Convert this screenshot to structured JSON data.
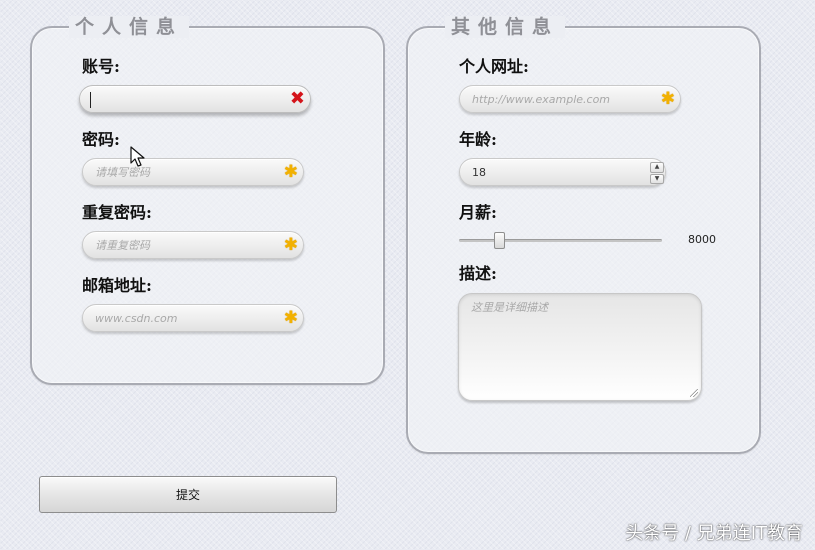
{
  "personal": {
    "legend": "个人信息",
    "account": {
      "label": "账号:",
      "value": "",
      "placeholder": ""
    },
    "password": {
      "label": "密码:",
      "placeholder": "请填写密码"
    },
    "confirm_password": {
      "label": "重复密码:",
      "placeholder": "请重复密码"
    },
    "email": {
      "label": "邮箱地址:",
      "placeholder": "www.csdn.com"
    }
  },
  "other": {
    "legend": "其他信息",
    "website": {
      "label": "个人网址:",
      "placeholder": "http://www.example.com"
    },
    "age": {
      "label": "年龄:",
      "value": "18"
    },
    "salary": {
      "label": "月薪:",
      "value": "8000",
      "level": 0.18
    },
    "description": {
      "label": "描述:",
      "placeholder": "这里是详细描述"
    }
  },
  "submit_label": "提交",
  "watermark": "头条号 / 兄弟连IT教育",
  "icons": {
    "required": "asterisk-icon",
    "invalid": "x-mark-icon",
    "spin_up": "spin-up-icon",
    "spin_down": "spin-down-icon",
    "cursor": "mouse-cursor-icon",
    "resize": "resize-grip-icon"
  },
  "colors": {
    "required_star": "#f2b100",
    "invalid_x": "#d4141a",
    "legend": "#8f9096"
  }
}
